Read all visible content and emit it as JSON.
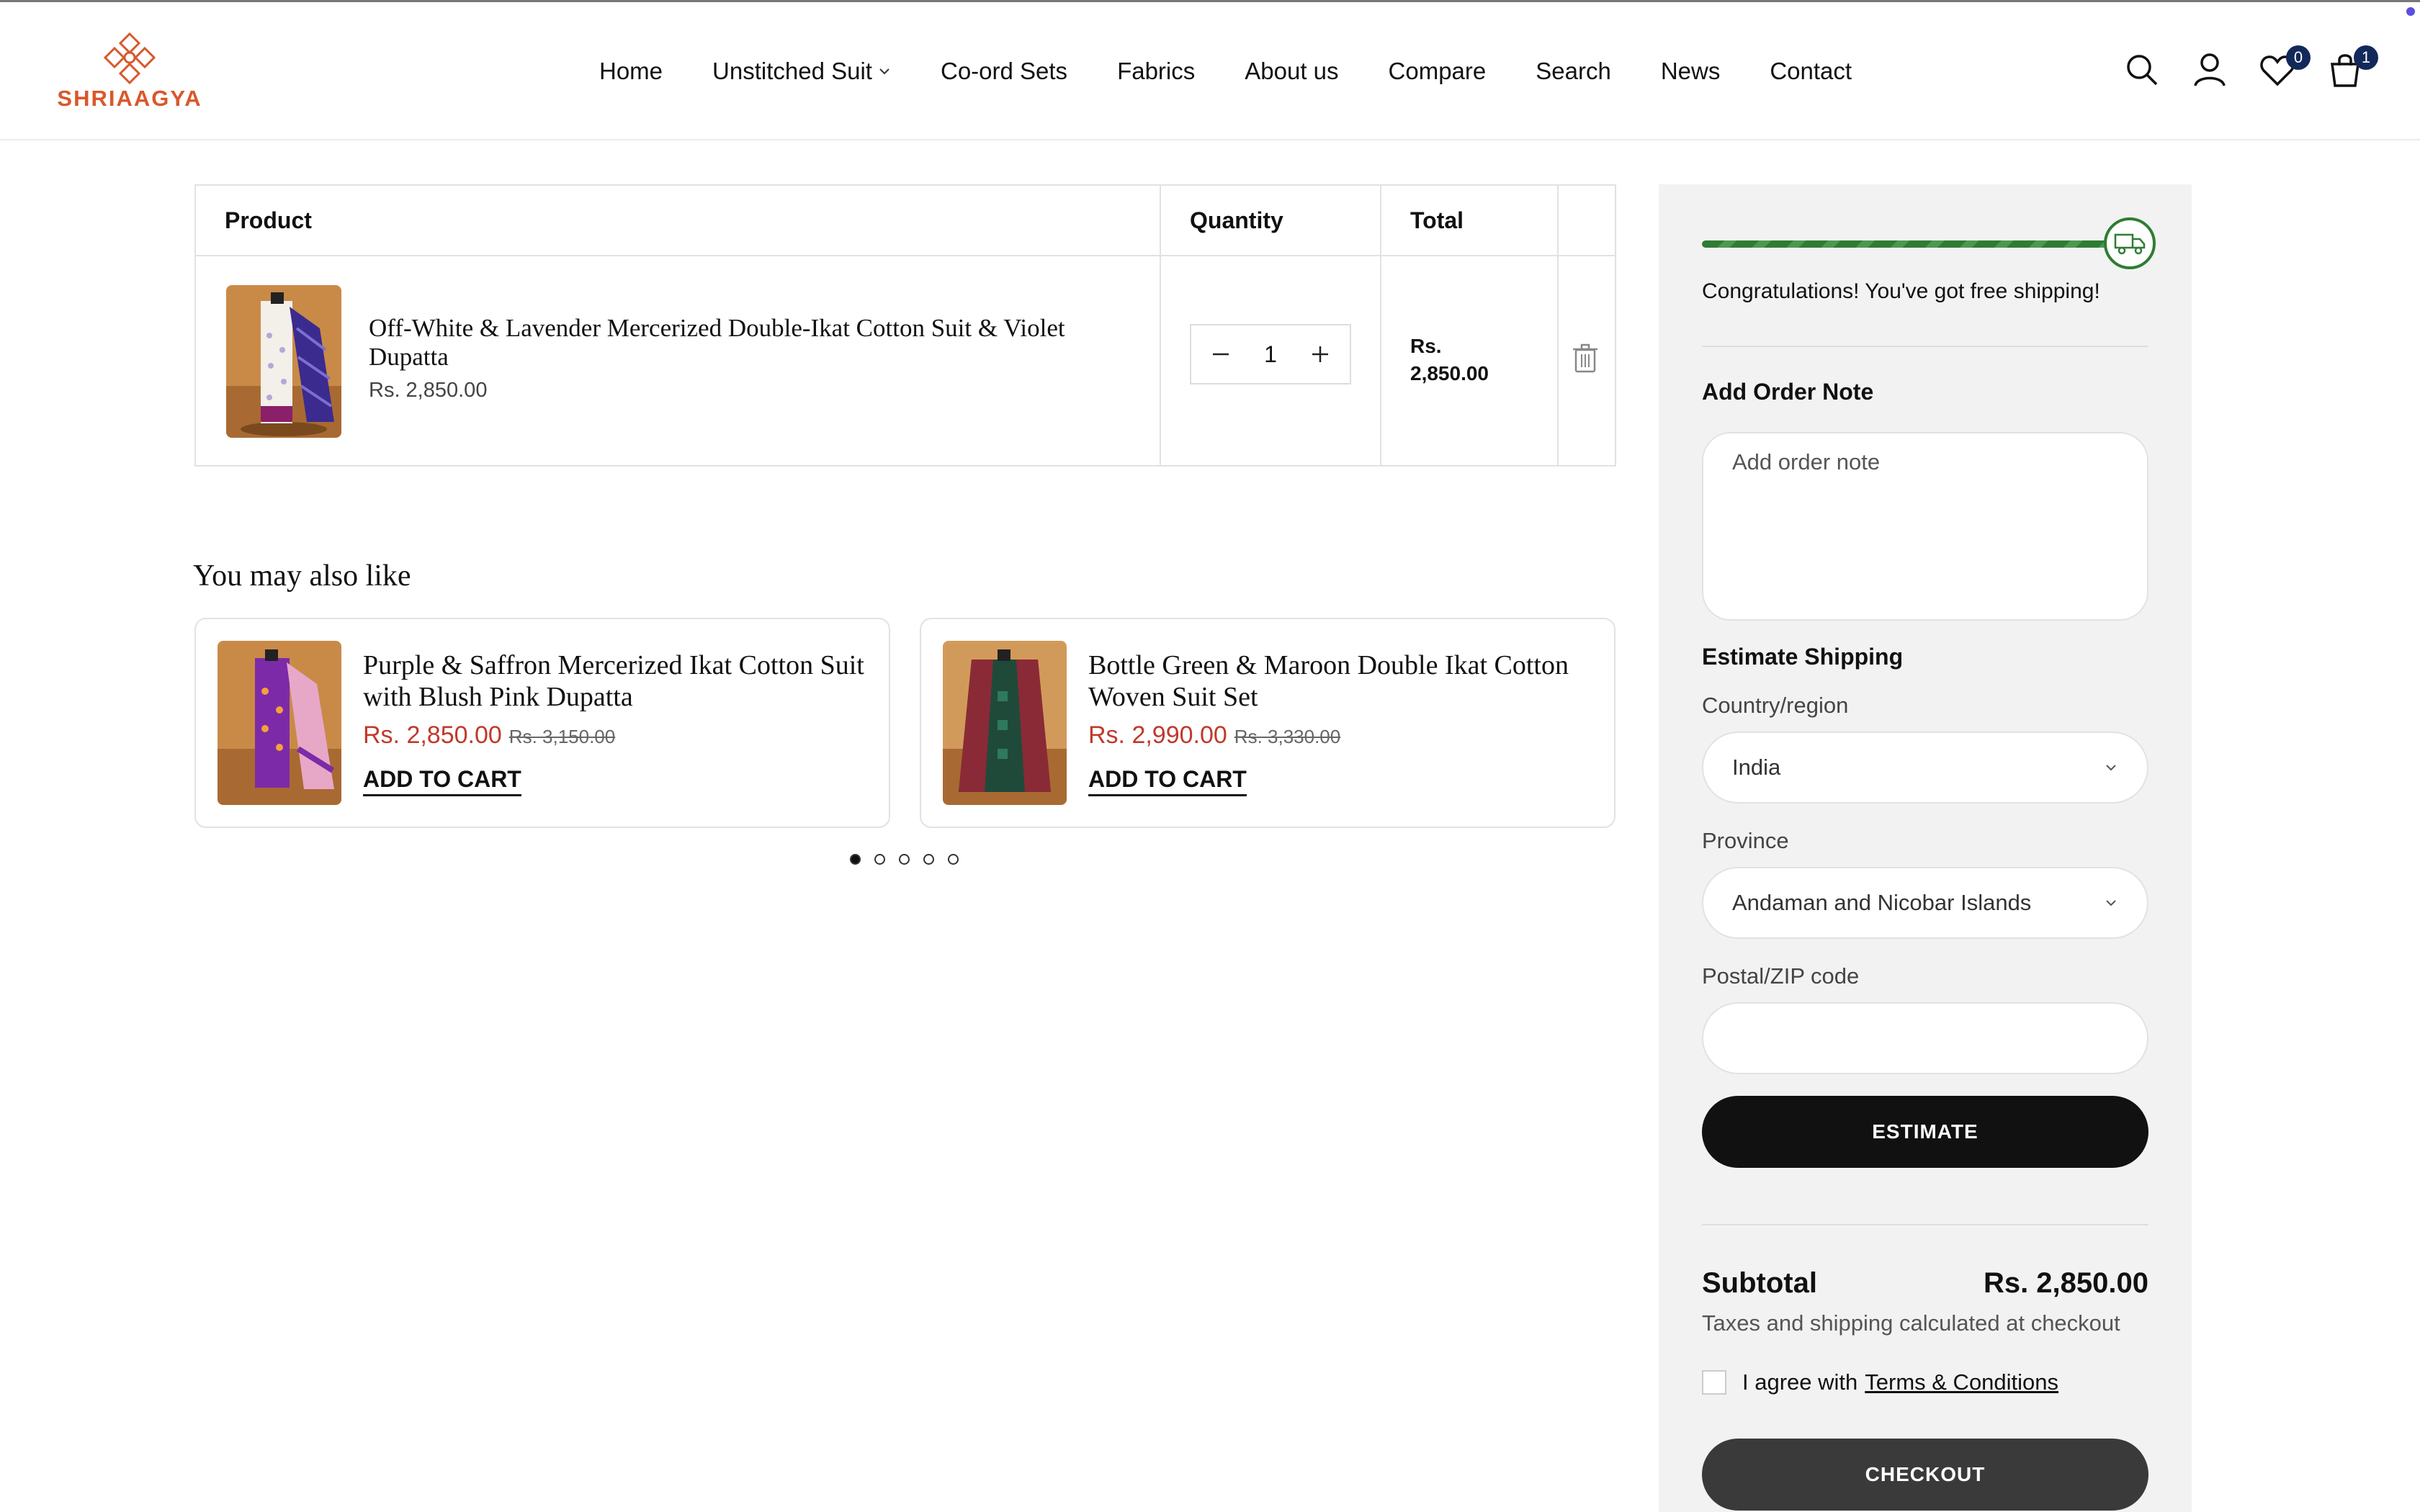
{
  "brand": {
    "name": "SHRIAAGYA",
    "color": "#d9582b"
  },
  "nav": [
    {
      "label": "Home"
    },
    {
      "label": "Unstitched Suit",
      "has_dropdown": true
    },
    {
      "label": "Co-ord Sets"
    },
    {
      "label": "Fabrics"
    },
    {
      "label": "About us"
    },
    {
      "label": "Compare"
    },
    {
      "label": "Search"
    },
    {
      "label": "News"
    },
    {
      "label": "Contact"
    }
  ],
  "header_icons": {
    "wishlist_count": "0",
    "cart_count": "1"
  },
  "cart": {
    "columns": {
      "product": "Product",
      "quantity": "Quantity",
      "total": "Total"
    },
    "item": {
      "name": "Off-White & Lavender Mercerized Double-Ikat Cotton Suit & Violet Dupatta",
      "price": "Rs. 2,850.00",
      "quantity": "1",
      "total_line1": "Rs.",
      "total_line2": "2,850.00"
    }
  },
  "recommendations": {
    "title": "You may also like",
    "items": [
      {
        "name": "Purple & Saffron Mercerized Ikat Cotton Suit with Blush Pink Dupatta",
        "price": "Rs. 2,850.00",
        "compare_price": "Rs. 3,150.00",
        "cta": "ADD TO CART"
      },
      {
        "name": "Bottle Green & Maroon Double Ikat Cotton Woven Suit Set",
        "price": "Rs. 2,990.00",
        "compare_price": "Rs. 3,330.00",
        "cta": "ADD TO CART"
      }
    ],
    "slides": 5,
    "active_slide": 1
  },
  "summary": {
    "shipping_progress": 1.0,
    "free_shipping_msg": "Congratulations! You've got free shipping!",
    "order_note_title": "Add Order Note",
    "order_note_placeholder": "Add order note",
    "estimate_title": "Estimate Shipping",
    "country_label": "Country/region",
    "country_value": "India",
    "province_label": "Province",
    "province_value": "Andaman and Nicobar Islands",
    "zip_label": "Postal/ZIP code",
    "zip_value": "",
    "estimate_btn": "ESTIMATE",
    "subtotal_label": "Subtotal",
    "subtotal_value": "Rs. 2,850.00",
    "taxes_note": "Taxes and shipping calculated at checkout",
    "agree_text": "I agree with",
    "terms_link": "Terms & Conditions",
    "checkout_btn": "CHECKOUT"
  },
  "colors": {
    "accent_green": "#2e7d32",
    "sale_red": "#c0392b",
    "dark_button": "#111111",
    "checkout_button": "#3a3a3a"
  }
}
